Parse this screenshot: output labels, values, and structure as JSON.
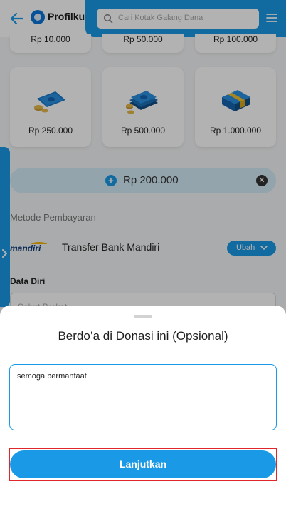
{
  "header": {
    "brand": "Profilku",
    "search_placeholder": "Cari Kotak Galang Dana"
  },
  "amount_options": [
    {
      "label": "Rp 10.000",
      "icon": "money-icon"
    },
    {
      "label": "Rp 50.000",
      "icon": "money-icon"
    },
    {
      "label": "Rp 100.000",
      "icon": "money-icon"
    },
    {
      "label": "Rp 250.000",
      "icon": "money-cash-coins-icon"
    },
    {
      "label": "Rp 500.000",
      "icon": "money-stack-coins-icon"
    },
    {
      "label": "Rp 1.000.000",
      "icon": "money-bundle-icon"
    }
  ],
  "custom_amount": {
    "value": "Rp 200.000"
  },
  "payment": {
    "section_title": "Metode Pembayaran",
    "bank_logo_text": "mandiri",
    "bank_name": "Transfer Bank Mandiri",
    "change_label": "Ubah"
  },
  "personal_data": {
    "section_title": "Data Diri",
    "name_placeholder": "Sebut Berkat"
  },
  "sheet": {
    "title": "Berdo’a di Donasi ini (Opsional)",
    "prayer_value": "semoga bermanfaat",
    "submit_label": "Lanjutkan"
  },
  "colors": {
    "primary": "#1a9ae6",
    "highlight": "#e0262b",
    "overlay": "rgba(0,0,0,0.30)"
  }
}
